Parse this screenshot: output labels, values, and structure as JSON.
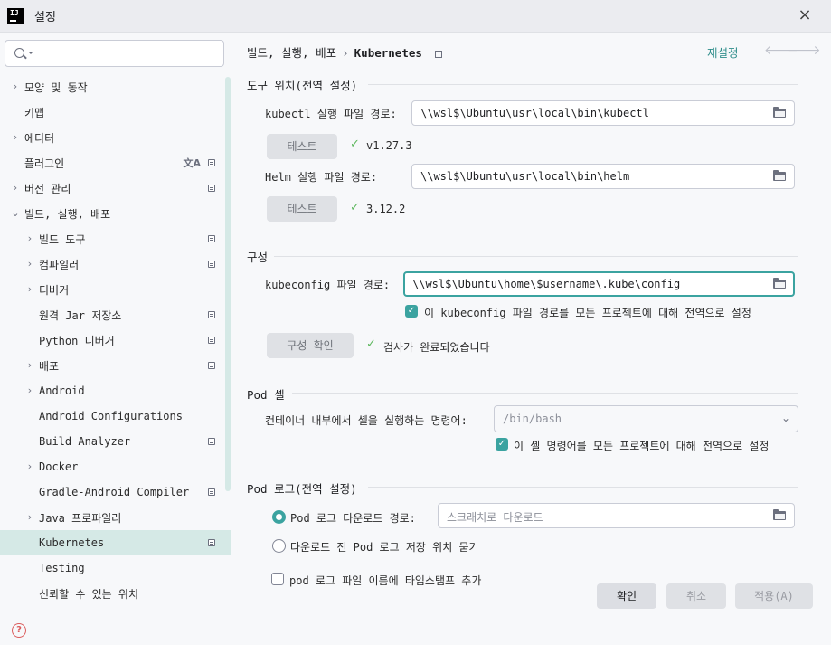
{
  "window": {
    "title": "설정",
    "logo_text": "IJ"
  },
  "search": {
    "placeholder": ""
  },
  "sidebar": {
    "items": [
      {
        "label": "모양 및 동작",
        "indent": 0,
        "chevron": true,
        "lock": false
      },
      {
        "label": "키맵",
        "indent": 0,
        "chevron": false,
        "lock": false
      },
      {
        "label": "에디터",
        "indent": 0,
        "chevron": true,
        "lock": false
      },
      {
        "label": "플러그인",
        "indent": 0,
        "chevron": false,
        "lock": true,
        "translate": true
      },
      {
        "label": "버전 관리",
        "indent": 0,
        "chevron": true,
        "lock": true
      },
      {
        "label": "빌드, 실행, 배포",
        "indent": 0,
        "chevron": true,
        "expanded": true,
        "lock": false
      },
      {
        "label": "빌드 도구",
        "indent": 1,
        "chevron": true,
        "lock": true
      },
      {
        "label": "컴파일러",
        "indent": 1,
        "chevron": true,
        "lock": true
      },
      {
        "label": "디버거",
        "indent": 1,
        "chevron": true,
        "lock": false
      },
      {
        "label": "원격 Jar 저장소",
        "indent": 1,
        "chevron": false,
        "lock": true
      },
      {
        "label": "Python 디버거",
        "indent": 1,
        "chevron": false,
        "lock": true
      },
      {
        "label": "배포",
        "indent": 1,
        "chevron": true,
        "lock": true
      },
      {
        "label": "Android",
        "indent": 1,
        "chevron": true,
        "lock": false
      },
      {
        "label": "Android Configurations",
        "indent": 1,
        "chevron": false,
        "lock": false
      },
      {
        "label": "Build Analyzer",
        "indent": 1,
        "chevron": false,
        "lock": true
      },
      {
        "label": "Docker",
        "indent": 1,
        "chevron": true,
        "lock": false
      },
      {
        "label": "Gradle-Android Compiler",
        "indent": 1,
        "chevron": false,
        "lock": true
      },
      {
        "label": "Java 프로파일러",
        "indent": 1,
        "chevron": true,
        "lock": false
      },
      {
        "label": "Kubernetes",
        "indent": 1,
        "chevron": false,
        "lock": true,
        "selected": true
      },
      {
        "label": "Testing",
        "indent": 1,
        "chevron": false,
        "lock": false
      },
      {
        "label": "신뢰할 수 있는 위치",
        "indent": 1,
        "chevron": false,
        "lock": false
      }
    ]
  },
  "breadcrumb": {
    "parent": "빌드, 실행, 배포",
    "separator": "›",
    "current": "Kubernetes"
  },
  "header": {
    "reset_label": "재설정",
    "back_arrow": "🡐",
    "forward_arrow": "🡒"
  },
  "tools": {
    "section_title": "도구 위치(전역 설정)",
    "kubectl_label": "kubectl 실행 파일 경로:",
    "kubectl_path": "\\\\wsl$\\Ubuntu\\usr\\local\\bin\\kubectl",
    "kubectl_test_label": "테스트",
    "kubectl_version": "v1.27.3",
    "helm_label": "Helm 실행 파일 경로:",
    "helm_path": "\\\\wsl$\\Ubuntu\\usr\\local\\bin\\helm",
    "helm_test_label": "테스트",
    "helm_version": "3.12.2"
  },
  "config": {
    "section_title": "구성",
    "kubeconfig_label": "kubeconfig 파일 경로:",
    "kubeconfig_path": "\\\\wsl$\\Ubuntu\\home\\$username\\.kube\\config",
    "global_checkbox_label": "이 kubeconfig 파일 경로를 모든 프로젝트에 대해 전역으로 설정",
    "global_checked": true,
    "verify_label": "구성 확인",
    "verify_result": "검사가 완료되었습니다"
  },
  "pod_shell": {
    "section_title": "Pod 셸",
    "command_label": "컨테이너 내부에서 셸을 실행하는 명령어:",
    "command_value": "/bin/bash",
    "global_checkbox_label": "이 셸 명령어를 모든 프로젝트에 대해 전역으로 설정",
    "global_checked": true
  },
  "pod_log": {
    "section_title": "Pod 로그(전역 설정)",
    "download_path_label": "Pod 로그 다운로드 경로:",
    "download_path_placeholder": "스크래치로 다운로드",
    "ask_label": "다운로드 전 Pod 로그 저장 위치 묻기",
    "timestamp_label": "pod 로그 파일 이름에 타임스탬프 추가",
    "selected_option": "download_path",
    "timestamp_checked": false
  },
  "footer": {
    "ok_label": "확인",
    "cancel_label": "취소",
    "apply_label": "적용(A)"
  },
  "colors": {
    "accent": "#3ba3a0",
    "selection": "#d5e9e6",
    "success": "#5fb85f",
    "help": "#db5c5c"
  }
}
